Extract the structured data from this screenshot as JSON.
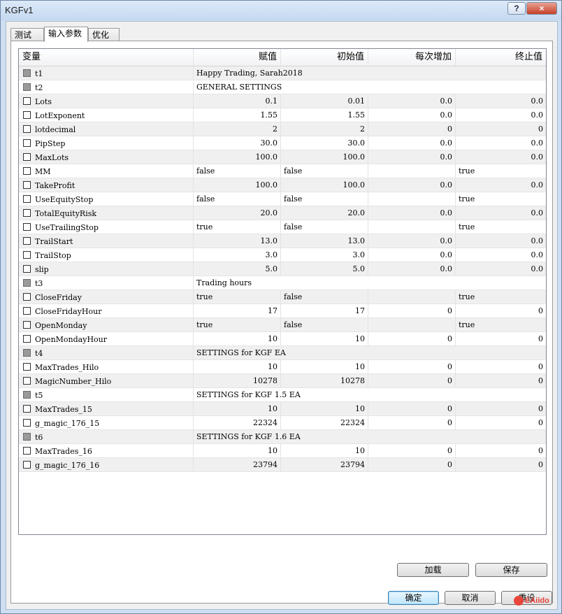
{
  "window": {
    "title": "KGFv1",
    "help": "?",
    "close": "×"
  },
  "tabs": [
    {
      "label": "测试",
      "active": false
    },
    {
      "label": "输入参数",
      "active": true
    },
    {
      "label": "优化",
      "active": false
    }
  ],
  "columns": [
    "变量",
    "赋值",
    "初始值",
    "每次增加",
    "终止值"
  ],
  "rows": [
    {
      "name": "t1",
      "span": "Happy Trading,    Sarah2018",
      "checkbox": "gray"
    },
    {
      "name": "t2",
      "span": "GENERAL SETTINGS",
      "checkbox": "gray"
    },
    {
      "name": "Lots",
      "value": "0.1",
      "start": "0.01",
      "step": "0.0",
      "stop": "0.0",
      "align": "right"
    },
    {
      "name": "LotExponent",
      "value": "1.55",
      "start": "1.55",
      "step": "0.0",
      "stop": "0.0",
      "align": "right"
    },
    {
      "name": "lotdecimal",
      "value": "2",
      "start": "2",
      "step": "0",
      "stop": "0",
      "align": "right"
    },
    {
      "name": "PipStep",
      "value": "30.0",
      "start": "30.0",
      "step": "0.0",
      "stop": "0.0",
      "align": "right"
    },
    {
      "name": "MaxLots",
      "value": "100.0",
      "start": "100.0",
      "step": "0.0",
      "stop": "0.0",
      "align": "right"
    },
    {
      "name": "MM",
      "value": "false",
      "start": "false",
      "step": "",
      "stop": "true",
      "align": "left"
    },
    {
      "name": "TakeProfit",
      "value": "100.0",
      "start": "100.0",
      "step": "0.0",
      "stop": "0.0",
      "align": "right"
    },
    {
      "name": "UseEquityStop",
      "value": "false",
      "start": "false",
      "step": "",
      "stop": "true",
      "align": "left"
    },
    {
      "name": "TotalEquityRisk",
      "value": "20.0",
      "start": "20.0",
      "step": "0.0",
      "stop": "0.0",
      "align": "right"
    },
    {
      "name": "UseTrailingStop",
      "value": "true",
      "start": "false",
      "step": "",
      "stop": "true",
      "align": "left"
    },
    {
      "name": "TrailStart",
      "value": "13.0",
      "start": "13.0",
      "step": "0.0",
      "stop": "0.0",
      "align": "right"
    },
    {
      "name": "TrailStop",
      "value": "3.0",
      "start": "3.0",
      "step": "0.0",
      "stop": "0.0",
      "align": "right"
    },
    {
      "name": "slip",
      "value": "5.0",
      "start": "5.0",
      "step": "0.0",
      "stop": "0.0",
      "align": "right"
    },
    {
      "name": "t3",
      "span": "Trading hours",
      "checkbox": "gray"
    },
    {
      "name": "CloseFriday",
      "value": "true",
      "start": "false",
      "step": "",
      "stop": "true",
      "align": "left"
    },
    {
      "name": "CloseFridayHour",
      "value": "17",
      "start": "17",
      "step": "0",
      "stop": "0",
      "align": "right"
    },
    {
      "name": "OpenMonday",
      "value": "true",
      "start": "false",
      "step": "",
      "stop": "true",
      "align": "left"
    },
    {
      "name": "OpenMondayHour",
      "value": "10",
      "start": "10",
      "step": "0",
      "stop": "0",
      "align": "right"
    },
    {
      "name": "t4",
      "span": "SETTINGS for KGF EA",
      "checkbox": "gray"
    },
    {
      "name": "MaxTrades_Hilo",
      "value": "10",
      "start": "10",
      "step": "0",
      "stop": "0",
      "align": "right"
    },
    {
      "name": "MagicNumber_Hilo",
      "value": "10278",
      "start": "10278",
      "step": "0",
      "stop": "0",
      "align": "right"
    },
    {
      "name": "t5",
      "span": "SETTINGS for KGF 1.5 EA",
      "checkbox": "gray"
    },
    {
      "name": "MaxTrades_15",
      "value": "10",
      "start": "10",
      "step": "0",
      "stop": "0",
      "align": "right"
    },
    {
      "name": "g_magic_176_15",
      "value": "22324",
      "start": "22324",
      "step": "0",
      "stop": "0",
      "align": "right"
    },
    {
      "name": "t6",
      "span": "SETTINGS for KGF 1.6 EA",
      "checkbox": "gray"
    },
    {
      "name": "MaxTrades_16",
      "value": "10",
      "start": "10",
      "step": "0",
      "stop": "0",
      "align": "right"
    },
    {
      "name": "g_magic_176_16",
      "value": "23794",
      "start": "23794",
      "step": "0",
      "stop": "0",
      "align": "right"
    }
  ],
  "buttons": {
    "load": "加载",
    "save": "保存",
    "ok": "确定",
    "cancel": "取消",
    "reset": "重设"
  },
  "watermark": "EAiido"
}
